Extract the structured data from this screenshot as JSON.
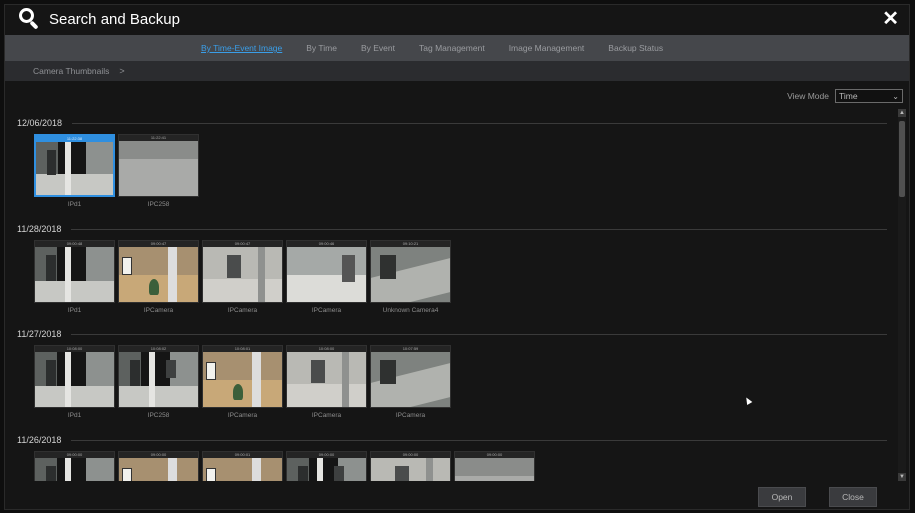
{
  "window": {
    "title": "Search and Backup"
  },
  "tabs": [
    {
      "label": "By Time-Event Image",
      "active": true
    },
    {
      "label": "By Time",
      "active": false
    },
    {
      "label": "By Event",
      "active": false
    },
    {
      "label": "Tag Management",
      "active": false
    },
    {
      "label": "Image Management",
      "active": false
    },
    {
      "label": "Backup Status",
      "active": false
    }
  ],
  "breadcrumb": {
    "label": "Camera Thumbnails",
    "arrow": ">"
  },
  "view_mode": {
    "label": "View Mode",
    "value": "Time"
  },
  "groups": [
    {
      "date": "12/06/2018",
      "items": [
        {
          "name": "IPd1",
          "time": "11:22:38",
          "selected": true,
          "scene": "corridor"
        },
        {
          "name": "IPC258",
          "time": "11:22:41",
          "selected": false,
          "scene": "grey"
        }
      ]
    },
    {
      "date": "11/28/2018",
      "items": [
        {
          "name": "IPd1",
          "time": "09:00:48",
          "selected": false,
          "scene": "corridor"
        },
        {
          "name": "IPCamera",
          "time": "09:00:47",
          "selected": false,
          "scene": "lobby"
        },
        {
          "name": "IPCamera",
          "time": "09:00:47",
          "selected": false,
          "scene": "hall"
        },
        {
          "name": "IPCamera",
          "time": "09:00:46",
          "selected": false,
          "scene": "room"
        },
        {
          "name": "Unknown Camera4",
          "time": "09:10:21",
          "selected": false,
          "scene": "tilted"
        }
      ]
    },
    {
      "date": "11/27/2018",
      "items": [
        {
          "name": "IPd1",
          "time": "10:08:00",
          "selected": false,
          "scene": "corridor"
        },
        {
          "name": "IPC258",
          "time": "10:08:02",
          "selected": false,
          "scene": "corridor2"
        },
        {
          "name": "IPCamera",
          "time": "10:08:01",
          "selected": false,
          "scene": "lobby"
        },
        {
          "name": "IPCamera",
          "time": "10:08:00",
          "selected": false,
          "scene": "hall"
        },
        {
          "name": "IPCamera",
          "time": "10:07:59",
          "selected": false,
          "scene": "tilted"
        }
      ]
    },
    {
      "date": "11/26/2018",
      "items": [
        {
          "name": "",
          "time": "09:00:00",
          "selected": false,
          "scene": "corridor"
        },
        {
          "name": "",
          "time": "09:00:00",
          "selected": false,
          "scene": "lobby"
        },
        {
          "name": "",
          "time": "09:00:01",
          "selected": false,
          "scene": "lobby"
        },
        {
          "name": "",
          "time": "09:00:00",
          "selected": false,
          "scene": "corridor2"
        },
        {
          "name": "",
          "time": "09:00:00",
          "selected": false,
          "scene": "hall"
        },
        {
          "name": "",
          "time": "09:00:00",
          "selected": false,
          "scene": "grey"
        }
      ]
    }
  ],
  "buttons": {
    "open": "Open",
    "close": "Close"
  },
  "icons": {
    "title": "search-icon",
    "close": "close-icon"
  },
  "colors": {
    "accent": "#2f8fe0",
    "tabbar": "#45474b",
    "background": "#151515"
  }
}
